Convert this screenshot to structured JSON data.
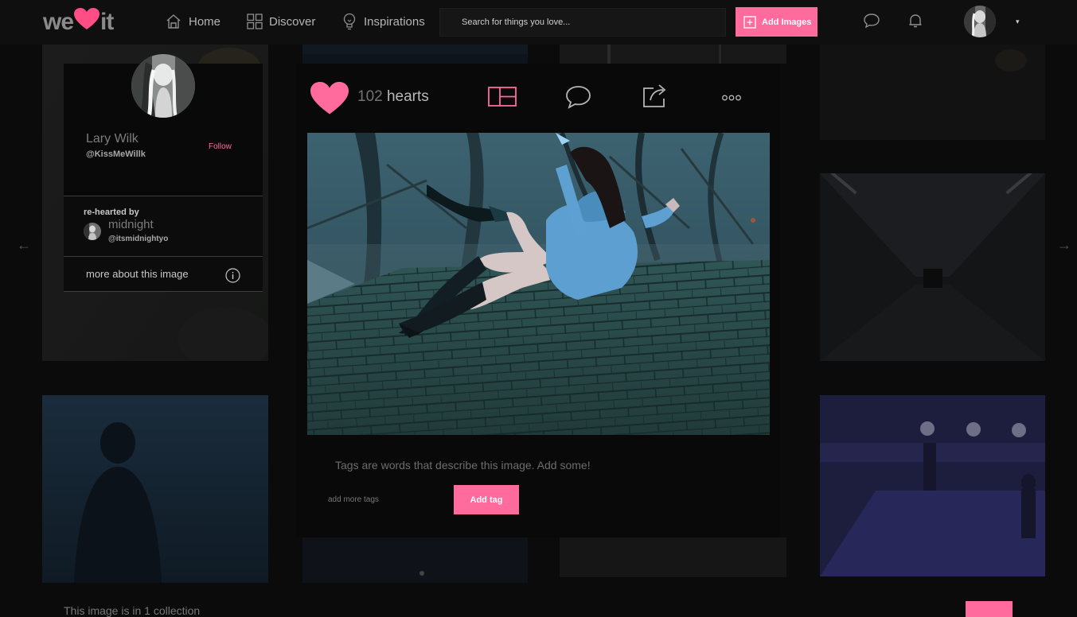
{
  "brand": {
    "left": "we",
    "right": "it"
  },
  "nav": {
    "home": "Home",
    "discover": "Discover",
    "inspirations": "Inspirations"
  },
  "search": {
    "placeholder": "Search for things you love..."
  },
  "add_images": "Add Images",
  "card": {
    "name": "Lary Wilk",
    "handle": "@KissMeWillk",
    "follow": "Follow",
    "rehearted_label": "re-hearted by",
    "rehearted_name": "midnight",
    "rehearted_handle": "@itsmidnightyo",
    "more_about": "more about this image"
  },
  "post": {
    "hearts_count": "102",
    "hearts_word": "hearts",
    "tags_hint": "Tags are words that describe this image. Add some!",
    "tag_placeholder": "add more tags",
    "add_tag": "Add tag"
  },
  "bottom": {
    "text": "This image is in 1 collection"
  },
  "colors": {
    "accent": "#ff6b9d",
    "background": "#0b0b0b"
  },
  "icons": [
    "house-icon",
    "grid-icon",
    "lightbulb-icon",
    "plus-square-icon",
    "chat-bubble-icon",
    "bell-icon",
    "heart-icon",
    "layout-icon",
    "share-icon",
    "ellipsis-icon",
    "info-icon",
    "arrow-left-icon",
    "arrow-right-icon"
  ]
}
